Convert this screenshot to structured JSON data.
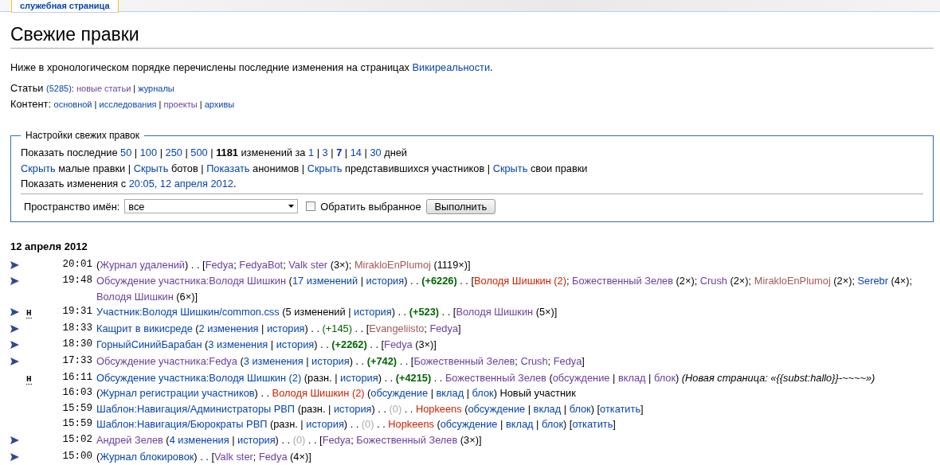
{
  "tabs": [
    {
      "label": "служебная страница",
      "selected": true
    }
  ],
  "title": "Свежие правки",
  "intro": [
    {
      "kind": "text",
      "text": "Ниже в хронологическом порядке перечислены последние изменения на страницах "
    },
    {
      "kind": "link",
      "text": "Викиреальности"
    },
    {
      "kind": "text",
      "text": "."
    }
  ],
  "articles_line": {
    "label": "Статьи ",
    "links": [
      {
        "kind": "link",
        "text": "(5285)"
      },
      {
        "kind": "text",
        "text": ": "
      },
      {
        "kind": "visited",
        "text": "новые статьи"
      },
      {
        "kind": "text",
        "text": " | "
      },
      {
        "kind": "link",
        "text": "журналы"
      }
    ]
  },
  "content_line": {
    "label": "Контент: ",
    "links": [
      {
        "kind": "link",
        "text": "основной"
      },
      {
        "kind": "text",
        "text": " | "
      },
      {
        "kind": "link",
        "text": "исследования"
      },
      {
        "kind": "text",
        "text": " | "
      },
      {
        "kind": "visited",
        "text": "проекты"
      },
      {
        "kind": "text",
        "text": " | "
      },
      {
        "kind": "link",
        "text": "архивы"
      }
    ]
  },
  "settings": {
    "legend": "Настройки свежих правок",
    "lines": [
      [
        {
          "kind": "text",
          "text": "Показать последние "
        },
        {
          "kind": "link",
          "text": "50"
        },
        {
          "kind": "text",
          "text": " | "
        },
        {
          "kind": "link",
          "text": "100"
        },
        {
          "kind": "text",
          "text": " | "
        },
        {
          "kind": "link",
          "text": "250"
        },
        {
          "kind": "text",
          "text": " | "
        },
        {
          "kind": "link",
          "text": "500"
        },
        {
          "kind": "text",
          "text": " | "
        },
        {
          "kind": "strong",
          "text": "1181"
        },
        {
          "kind": "text",
          "text": " изменений за "
        },
        {
          "kind": "link",
          "text": "1"
        },
        {
          "kind": "text",
          "text": " | "
        },
        {
          "kind": "link",
          "text": "3"
        },
        {
          "kind": "text",
          "text": " | "
        },
        {
          "kind": "current",
          "text": "7"
        },
        {
          "kind": "text",
          "text": " | "
        },
        {
          "kind": "link",
          "text": "14"
        },
        {
          "kind": "text",
          "text": " | "
        },
        {
          "kind": "link",
          "text": "30"
        },
        {
          "kind": "text",
          "text": " дней"
        }
      ],
      [
        {
          "kind": "link",
          "text": "Скрыть"
        },
        {
          "kind": "text",
          "text": " малые правки | "
        },
        {
          "kind": "link",
          "text": "Скрыть"
        },
        {
          "kind": "text",
          "text": " ботов | "
        },
        {
          "kind": "link",
          "text": "Показать"
        },
        {
          "kind": "text",
          "text": " анонимов | "
        },
        {
          "kind": "link",
          "text": "Скрыть"
        },
        {
          "kind": "text",
          "text": " представившихся участников | "
        },
        {
          "kind": "link",
          "text": "Скрыть"
        },
        {
          "kind": "text",
          "text": " свои правки"
        }
      ],
      [
        {
          "kind": "text",
          "text": "Показать изменения с "
        },
        {
          "kind": "link",
          "text": "20:05, 12 апреля 2012"
        },
        {
          "kind": "text",
          "text": "."
        }
      ]
    ],
    "namespace_label": "Пространство имён:",
    "namespace_value": "все",
    "invert": {
      "label": "Обратить выбранное",
      "checked": false
    },
    "submit": "Выполнить"
  },
  "date_heading": "12 апреля 2012",
  "changes": [
    {
      "expandable": true,
      "time": "20:01",
      "segments": [
        {
          "kind": "text",
          "text": "("
        },
        {
          "kind": "visited",
          "text": "Журнал удалений"
        },
        {
          "kind": "text",
          "text": ") . . ["
        },
        {
          "kind": "visited",
          "text": "Fedya"
        },
        {
          "kind": "text",
          "text": "; "
        },
        {
          "kind": "visited",
          "text": "FedyaBot"
        },
        {
          "kind": "text",
          "text": "; "
        },
        {
          "kind": "visited",
          "text": "Valk ster"
        },
        {
          "kind": "text",
          "text": " (3×); "
        },
        {
          "kind": "new_visited",
          "text": "MirakloEnPlumoj"
        },
        {
          "kind": "text",
          "text": " (1119×)]"
        }
      ]
    },
    {
      "expandable": true,
      "time": "19:48",
      "segments": [
        {
          "kind": "visited",
          "text": "Обсуждение участника:Володя Шишкин"
        },
        {
          "kind": "text",
          "text": " ("
        },
        {
          "kind": "link",
          "text": "17 изменений"
        },
        {
          "kind": "text",
          "text": " | "
        },
        {
          "kind": "link",
          "text": "история"
        },
        {
          "kind": "text",
          "text": ") . . "
        },
        {
          "kind": "size_big",
          "text": "(+6226)"
        },
        {
          "kind": "text",
          "text": " . . ["
        },
        {
          "kind": "new",
          "text": "Володя Шишкин (2)"
        },
        {
          "kind": "text",
          "text": "; "
        },
        {
          "kind": "visited",
          "text": "Божественный Зелев"
        },
        {
          "kind": "text",
          "text": " (2×); "
        },
        {
          "kind": "visited",
          "text": "Crush"
        },
        {
          "kind": "text",
          "text": " (2×); "
        },
        {
          "kind": "new_visited",
          "text": "MirakloEnPlumoj"
        },
        {
          "kind": "text",
          "text": " (2×); "
        },
        {
          "kind": "link",
          "text": "Serebr"
        },
        {
          "kind": "text",
          "text": " (4×); "
        },
        {
          "kind": "visited",
          "text": "Володя Шишкин"
        },
        {
          "kind": "text",
          "text": " (6×)]"
        }
      ]
    },
    {
      "expandable": true,
      "flag": "Н",
      "time": "19:31",
      "segments": [
        {
          "kind": "link",
          "text": "Участник:Володя Шишкин/common.css"
        },
        {
          "kind": "text",
          "text": " (5 изменений | "
        },
        {
          "kind": "link",
          "text": "история"
        },
        {
          "kind": "text",
          "text": ") . . "
        },
        {
          "kind": "size_big",
          "text": "(+523)"
        },
        {
          "kind": "text",
          "text": " . . ["
        },
        {
          "kind": "visited",
          "text": "Володя Шишкин"
        },
        {
          "kind": "text",
          "text": " (5×)]"
        }
      ]
    },
    {
      "expandable": true,
      "time": "18:33",
      "segments": [
        {
          "kind": "link",
          "text": "Кащрит в викисреде"
        },
        {
          "kind": "text",
          "text": " ("
        },
        {
          "kind": "link",
          "text": "2 изменения"
        },
        {
          "kind": "text",
          "text": " | "
        },
        {
          "kind": "link",
          "text": "история"
        },
        {
          "kind": "text",
          "text": ") . . "
        },
        {
          "kind": "size",
          "text": "(+145)"
        },
        {
          "kind": "text",
          "text": " . . ["
        },
        {
          "kind": "new_visited",
          "text": "Evangeliisto"
        },
        {
          "kind": "text",
          "text": "; "
        },
        {
          "kind": "visited",
          "text": "Fedya"
        },
        {
          "kind": "text",
          "text": "]"
        }
      ]
    },
    {
      "expandable": true,
      "time": "18:30",
      "segments": [
        {
          "kind": "link",
          "text": "ГорныйСинийБарабан"
        },
        {
          "kind": "text",
          "text": " ("
        },
        {
          "kind": "link",
          "text": "3 изменения"
        },
        {
          "kind": "text",
          "text": " | "
        },
        {
          "kind": "link",
          "text": "история"
        },
        {
          "kind": "text",
          "text": ") . . "
        },
        {
          "kind": "size_big",
          "text": "(+2262)"
        },
        {
          "kind": "text",
          "text": " . . ["
        },
        {
          "kind": "visited",
          "text": "Fedya"
        },
        {
          "kind": "text",
          "text": " (3×)]"
        }
      ]
    },
    {
      "expandable": true,
      "time": "17:33",
      "segments": [
        {
          "kind": "visited",
          "text": "Обсуждение участника:Fedya"
        },
        {
          "kind": "text",
          "text": " ("
        },
        {
          "kind": "link",
          "text": "3 изменения"
        },
        {
          "kind": "text",
          "text": " | "
        },
        {
          "kind": "link",
          "text": "история"
        },
        {
          "kind": "text",
          "text": ") . . "
        },
        {
          "kind": "size_big",
          "text": "(+742)"
        },
        {
          "kind": "text",
          "text": " . . ["
        },
        {
          "kind": "visited",
          "text": "Божественный Зелев"
        },
        {
          "kind": "text",
          "text": "; "
        },
        {
          "kind": "visited",
          "text": "Crush"
        },
        {
          "kind": "text",
          "text": "; "
        },
        {
          "kind": "visited",
          "text": "Fedya"
        },
        {
          "kind": "text",
          "text": "]"
        }
      ]
    },
    {
      "expandable": false,
      "flag": "Н",
      "time": "16:11",
      "segments": [
        {
          "kind": "link",
          "text": "Обсуждение участника:Володя Шишкин (2)"
        },
        {
          "kind": "text",
          "text": " (разн. | "
        },
        {
          "kind": "link",
          "text": "история"
        },
        {
          "kind": "text",
          "text": ") . . "
        },
        {
          "kind": "size_big",
          "text": "(+4215)"
        },
        {
          "kind": "text",
          "text": " . . "
        },
        {
          "kind": "visited",
          "text": "Божественный Зелев"
        },
        {
          "kind": "text",
          "text": " ("
        },
        {
          "kind": "visited",
          "text": "обсуждение"
        },
        {
          "kind": "text",
          "text": " | "
        },
        {
          "kind": "visited",
          "text": "вклад"
        },
        {
          "kind": "text",
          "text": " | "
        },
        {
          "kind": "visited",
          "text": "блок"
        },
        {
          "kind": "text",
          "text": ") "
        },
        {
          "kind": "comment",
          "text": "(Новая страница: «{{subst:hallo}}-~~~~»)"
        }
      ]
    },
    {
      "expandable": false,
      "time": "16:03",
      "segments": [
        {
          "kind": "text",
          "text": "("
        },
        {
          "kind": "link",
          "text": "Журнал регистрации участников"
        },
        {
          "kind": "text",
          "text": ") . . "
        },
        {
          "kind": "new",
          "text": "Володя Шишкин (2)"
        },
        {
          "kind": "text",
          "text": " ("
        },
        {
          "kind": "link",
          "text": "обсуждение"
        },
        {
          "kind": "text",
          "text": " | "
        },
        {
          "kind": "link",
          "text": "вклад"
        },
        {
          "kind": "text",
          "text": " | "
        },
        {
          "kind": "link",
          "text": "блок"
        },
        {
          "kind": "text",
          "text": ") Новый участник"
        }
      ]
    },
    {
      "expandable": false,
      "time": "15:59",
      "segments": [
        {
          "kind": "link",
          "text": "Шаблон:Навигация/Администраторы РВП"
        },
        {
          "kind": "text",
          "text": " (разн. | "
        },
        {
          "kind": "link",
          "text": "история"
        },
        {
          "kind": "text",
          "text": ") . . "
        },
        {
          "kind": "size_zero",
          "text": "(0)"
        },
        {
          "kind": "text",
          "text": " . . "
        },
        {
          "kind": "new",
          "text": "Hopkeens"
        },
        {
          "kind": "text",
          "text": " ("
        },
        {
          "kind": "link",
          "text": "обсуждение"
        },
        {
          "kind": "text",
          "text": " | "
        },
        {
          "kind": "link",
          "text": "вклад"
        },
        {
          "kind": "text",
          "text": " | "
        },
        {
          "kind": "link",
          "text": "блок"
        },
        {
          "kind": "text",
          "text": ") ["
        },
        {
          "kind": "link",
          "text": "откатить"
        },
        {
          "kind": "text",
          "text": "]"
        }
      ]
    },
    {
      "expandable": false,
      "time": "15:59",
      "segments": [
        {
          "kind": "link",
          "text": "Шаблон:Навигация/Бюрократы РВП"
        },
        {
          "kind": "text",
          "text": " (разн. | "
        },
        {
          "kind": "link",
          "text": "история"
        },
        {
          "kind": "text",
          "text": ") . . "
        },
        {
          "kind": "size_zero",
          "text": "(0)"
        },
        {
          "kind": "text",
          "text": " . . "
        },
        {
          "kind": "new",
          "text": "Hopkeens"
        },
        {
          "kind": "text",
          "text": " ("
        },
        {
          "kind": "link",
          "text": "обсуждение"
        },
        {
          "kind": "text",
          "text": " | "
        },
        {
          "kind": "link",
          "text": "вклад"
        },
        {
          "kind": "text",
          "text": " | "
        },
        {
          "kind": "link",
          "text": "блок"
        },
        {
          "kind": "text",
          "text": ") ["
        },
        {
          "kind": "link",
          "text": "откатить"
        },
        {
          "kind": "text",
          "text": "]"
        }
      ]
    },
    {
      "expandable": true,
      "time": "15:02",
      "segments": [
        {
          "kind": "visited",
          "text": "Андрей Зелев"
        },
        {
          "kind": "text",
          "text": " ("
        },
        {
          "kind": "link",
          "text": "4 изменения"
        },
        {
          "kind": "text",
          "text": " | "
        },
        {
          "kind": "link",
          "text": "история"
        },
        {
          "kind": "text",
          "text": ") . . "
        },
        {
          "kind": "size_zero",
          "text": "(0)"
        },
        {
          "kind": "text",
          "text": " . . ["
        },
        {
          "kind": "visited",
          "text": "Fedya"
        },
        {
          "kind": "text",
          "text": "; "
        },
        {
          "kind": "visited",
          "text": "Божественный Зелев"
        },
        {
          "kind": "text",
          "text": " (3×)]"
        }
      ]
    },
    {
      "expandable": true,
      "time": "15:00",
      "segments": [
        {
          "kind": "text",
          "text": "("
        },
        {
          "kind": "link",
          "text": "Журнал блокировок"
        },
        {
          "kind": "text",
          "text": ") . . ["
        },
        {
          "kind": "visited",
          "text": "Valk ster"
        },
        {
          "kind": "text",
          "text": "; "
        },
        {
          "kind": "visited",
          "text": "Fedya"
        },
        {
          "kind": "text",
          "text": " (4×)]"
        }
      ]
    }
  ]
}
